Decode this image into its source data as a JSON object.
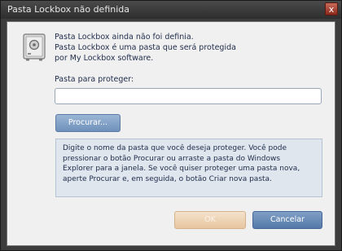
{
  "window": {
    "title": "Pasta Lockbox não definida",
    "close_symbol": "x"
  },
  "intro": {
    "icon": "safe-icon",
    "lines": [
      "Pasta Lockbox ainda não foi definia.",
      "Pasta Lockbox é uma pasta que será protegida",
      "por My Lockbox software."
    ]
  },
  "folder_field": {
    "label": "Pasta para proteger:",
    "value": ""
  },
  "browse_button": {
    "label": "Procurar..."
  },
  "help": {
    "lines": [
      "Digite o nome da pasta que você deseja proteger. Você pode",
      "pressionar o botão Procurar ou arraste a pasta do Windows",
      "Explorer para a janela. Se você quiser proteger uma pasta nova,",
      "aperte Procurar e, em seguida, o botão Criar nova pasta."
    ]
  },
  "buttons": {
    "ok": "OK",
    "cancel": "Cancelar"
  },
  "colors": {
    "window_frame": "#3c3c3c",
    "client_bg": "#f0f0f0",
    "help_bg": "#dfe6ee",
    "accent_blue": "#6f91bb",
    "ok_disabled": "#e7c6a0",
    "text": "#1e2b4a"
  }
}
